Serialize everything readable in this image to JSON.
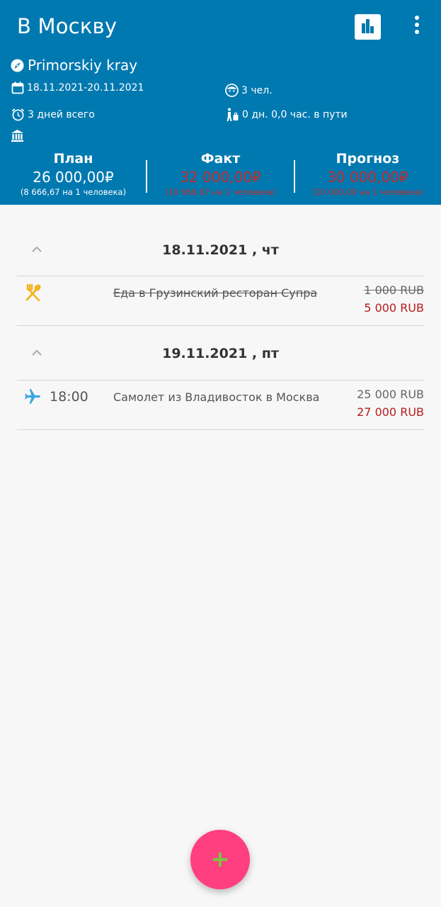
{
  "header": {
    "title": "В Москву",
    "region": "Primorskiy kray",
    "dates": "18.11.2021-20.11.2021",
    "people": "3 чел.",
    "days_total": "3 дней всего",
    "in_transit": "0 дн. 0,0 час. в пути"
  },
  "summary": {
    "plan": {
      "title": "План",
      "value": "26 000,00₽",
      "per_person": "(8 666,67 на 1 человека)"
    },
    "fact": {
      "title": "Факт",
      "value": "32 000,00₽",
      "per_person": "(10 666,67 на 1 человека)"
    },
    "forecast": {
      "title": "Прогноз",
      "value": "30 000,00₽",
      "per_person": "(10 000,00 на 1 человека)"
    }
  },
  "days": [
    {
      "date": "18.11.2021 , чт",
      "items": [
        {
          "icon": "food-icon",
          "time": "",
          "label": "Еда в Грузинский ресторан Супра",
          "planned": "1 000 RUB",
          "actual": "5 000 RUB"
        }
      ]
    },
    {
      "date": "19.11.2021 , пт",
      "items": [
        {
          "icon": "airplane-icon",
          "time": "18:00",
          "label": "Самолет из Владивосток  в Москва",
          "planned": "25 000 RUB",
          "actual": "27 000 RUB"
        }
      ]
    }
  ],
  "colors": {
    "header_bg": "#0079b0",
    "fab_bg": "#ff3f7f",
    "fab_plus": "#7cc242",
    "over_budget_red": "#c62828",
    "food_icon": "#f2b420",
    "plane_icon": "#3aa7e0"
  }
}
